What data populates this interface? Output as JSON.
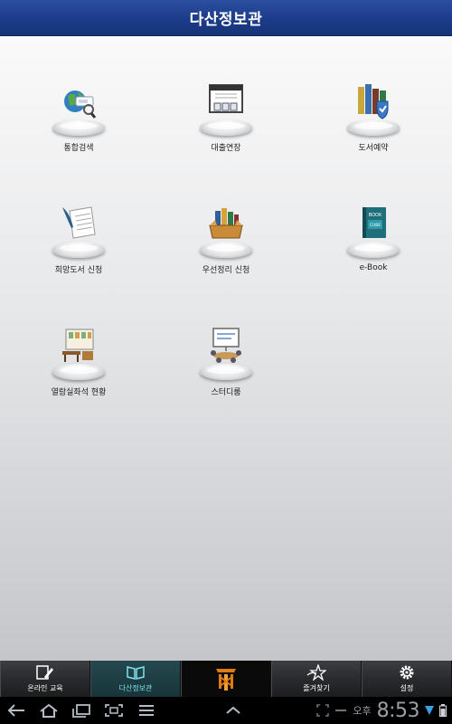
{
  "header": {
    "title": "다산정보관"
  },
  "tiles": [
    {
      "label": "통합검색",
      "icon": "globe-search-icon"
    },
    {
      "label": "대출연장",
      "icon": "calendar-icon"
    },
    {
      "label": "도서예약",
      "icon": "books-shield-icon"
    },
    {
      "label": "희망도서 신청",
      "icon": "quill-paper-icon"
    },
    {
      "label": "우선정리 신청",
      "icon": "book-box-icon"
    },
    {
      "label": "e-Book",
      "icon": "ebook-icon"
    },
    {
      "label": "열람실좌석 현황",
      "icon": "reading-room-icon"
    },
    {
      "label": "스터디룸",
      "icon": "study-room-icon"
    }
  ],
  "tabbar": {
    "items": [
      {
        "label": "온라인 교육",
        "icon": "edit-icon"
      },
      {
        "label": "다산정보관",
        "icon": "open-book-icon",
        "active": true
      },
      {
        "label": "",
        "icon": "university-logo-icon"
      },
      {
        "label": "즐겨찾기",
        "icon": "star-icon"
      },
      {
        "label": "설정",
        "icon": "gear-icon"
      }
    ]
  },
  "sysbar": {
    "ampm": "오후",
    "time": "8:53"
  },
  "colors": {
    "header": "#1f3f8e",
    "active_tab_text": "#7fe3f0",
    "logo": "#e07a10"
  }
}
